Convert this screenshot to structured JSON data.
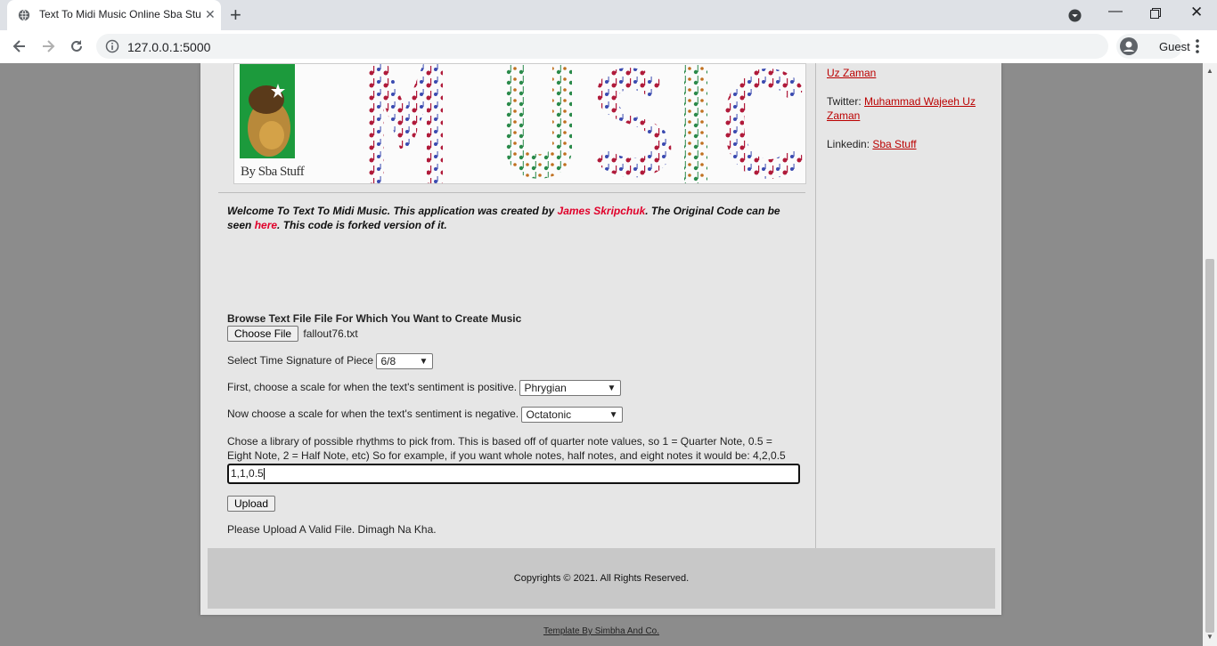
{
  "browser": {
    "tab_title": "Text To Midi Music Online Sba Stuff",
    "url": "127.0.0.1:5000",
    "profile_label": "Guest"
  },
  "banner": {
    "byline": "By Sba Stuff"
  },
  "welcome": {
    "p1": "Welcome To Text To Midi Music. This application was created by ",
    "author": "James Skripchuk",
    "p2": ". The Original Code can be seen ",
    "here": "here",
    "p3": ". This code is forked version of it."
  },
  "form": {
    "file_label": "Browse Text File File For Which You Want to Create Music",
    "choose_file": "Choose File",
    "file_name": "fallout76.txt",
    "time_sig_label": "Select Time Signature of Piece",
    "time_sig_value": "6/8",
    "positive_label": "First, choose a scale for when the text's sentiment is positive.",
    "positive_value": "Phrygian",
    "negative_label": "Now choose a scale for when the text's sentiment is negative.",
    "negative_value": "Octatonic",
    "rhythm_label": "Chose a library of possible rhythms to pick from. This is based off of quarter note values, so 1 = Quarter Note, 0.5 = Eight Note, 2 = Half Note, etc) So for example, if you want whole notes, half notes, and eight notes it would be: 4,2,0.5",
    "rhythm_value": "1,1,0.5",
    "upload": "Upload",
    "message": "Please Upload A Valid File. Dimagh Na Kha."
  },
  "sidebar": {
    "top_link_tail": "Uz Zaman",
    "twitter_label": "Twitter: ",
    "twitter_link": "Muhammad Wajeeh Uz Zaman",
    "linkedin_label": "Linkedin: ",
    "linkedin_link": "Sba Stuff"
  },
  "footer": {
    "copyright": "Copyrights © 2021. All Rights Reserved.",
    "template": "Template By Simbha And Co."
  },
  "colors": {
    "link_red": "#e0002a",
    "sidebar_link": "#b00000",
    "page_bg": "#8c8c8c",
    "container_bg": "#e6e6e6",
    "footer_bg": "#c8c8c8"
  }
}
